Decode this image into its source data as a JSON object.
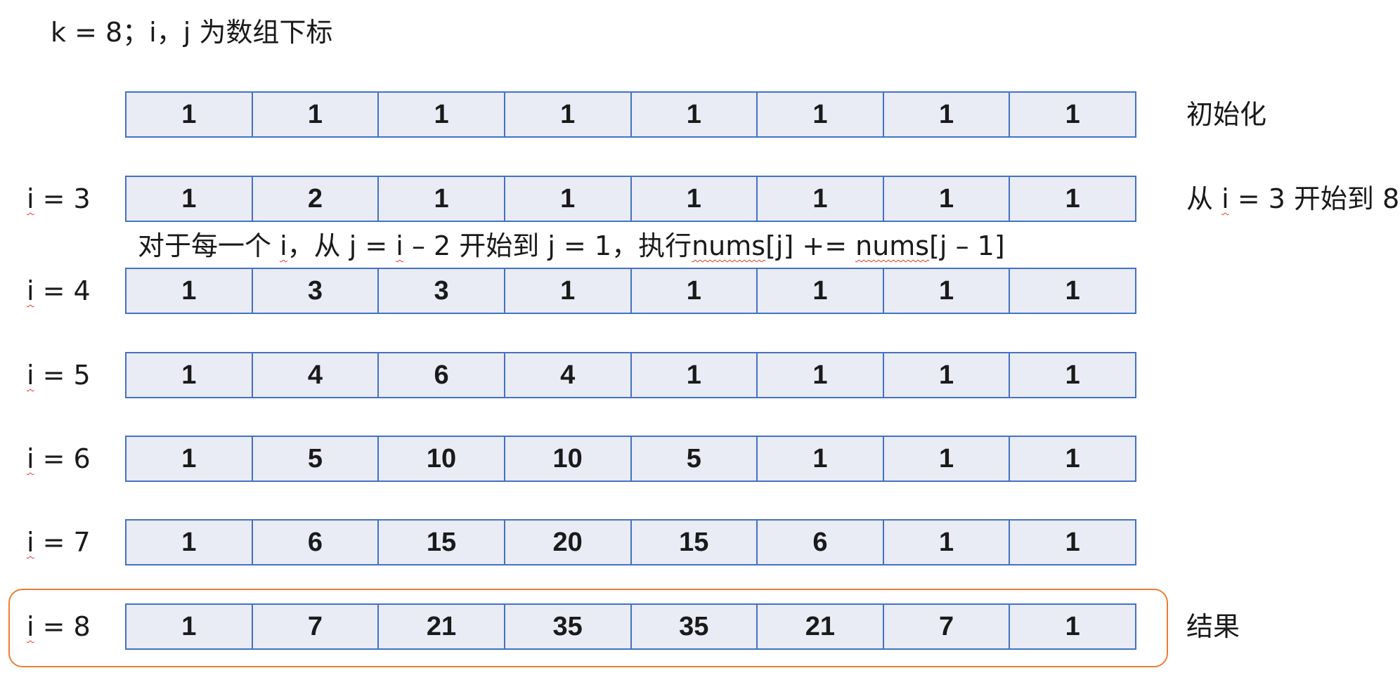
{
  "header_note": "k = 8；i，j 为数组下标",
  "step_note": {
    "part1": "对于每一个 ",
    "part2": "i",
    "part3": "，从 j = ",
    "part4": "i",
    "part5": " – 2 开始到 j = 1，执行",
    "part6": "nums",
    "part7": "[j] += ",
    "part8": "nums",
    "part9": "[j – 1]"
  },
  "rows": [
    {
      "label_var": "",
      "label_rest": "",
      "cells": [
        "1",
        "1",
        "1",
        "1",
        "1",
        "1",
        "1",
        "1"
      ],
      "side_a": "初始化",
      "side_b": "",
      "side_c": ""
    },
    {
      "label_var": "i",
      "label_rest": " = 3",
      "cells": [
        "1",
        "2",
        "1",
        "1",
        "1",
        "1",
        "1",
        "1"
      ],
      "side_a": "从 ",
      "side_b": "i",
      "side_c": " = 3 开始到 8"
    },
    {
      "label_var": "i",
      "label_rest": " = 4",
      "cells": [
        "1",
        "3",
        "3",
        "1",
        "1",
        "1",
        "1",
        "1"
      ],
      "side_a": "",
      "side_b": "",
      "side_c": ""
    },
    {
      "label_var": "i",
      "label_rest": " = 5",
      "cells": [
        "1",
        "4",
        "6",
        "4",
        "1",
        "1",
        "1",
        "1"
      ],
      "side_a": "",
      "side_b": "",
      "side_c": ""
    },
    {
      "label_var": "i",
      "label_rest": " = 6",
      "cells": [
        "1",
        "5",
        "10",
        "10",
        "5",
        "1",
        "1",
        "1"
      ],
      "side_a": "",
      "side_b": "",
      "side_c": ""
    },
    {
      "label_var": "i",
      "label_rest": " = 7",
      "cells": [
        "1",
        "6",
        "15",
        "20",
        "15",
        "6",
        "1",
        "1"
      ],
      "side_a": "",
      "side_b": "",
      "side_c": ""
    },
    {
      "label_var": "i",
      "label_rest": " = 8",
      "cells": [
        "1",
        "7",
        "21",
        "35",
        "35",
        "21",
        "7",
        "1"
      ],
      "side_a": "结果",
      "side_b": "",
      "side_c": ""
    }
  ],
  "colors": {
    "cell_fill": "#e9ebf5",
    "cell_border": "#4472c4",
    "result_box_border": "#ed7d31",
    "spellcheck_underline": "#e0392b"
  }
}
